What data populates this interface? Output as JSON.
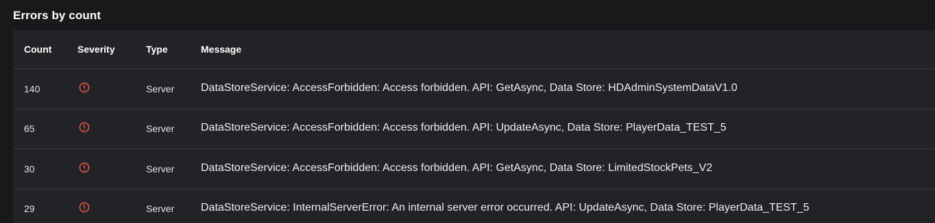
{
  "section": {
    "title": "Errors by count"
  },
  "table": {
    "headers": {
      "count": "Count",
      "severity": "Severity",
      "type": "Type",
      "message": "Message"
    },
    "rows": [
      {
        "count": "140",
        "severity_icon": "error-circle-icon",
        "type": "Server",
        "message": "DataStoreService: AccessForbidden: Access forbidden. API: GetAsync, Data Store: HDAdminSystemDataV1.0"
      },
      {
        "count": "65",
        "severity_icon": "error-circle-icon",
        "type": "Server",
        "message": "DataStoreService: AccessForbidden: Access forbidden. API: UpdateAsync, Data Store: PlayerData_TEST_5"
      },
      {
        "count": "30",
        "severity_icon": "error-circle-icon",
        "type": "Server",
        "message": "DataStoreService: AccessForbidden: Access forbidden. API: GetAsync, Data Store: LimitedStockPets_V2"
      },
      {
        "count": "29",
        "severity_icon": "error-circle-icon",
        "type": "Server",
        "message": "DataStoreService: InternalServerError: An internal server error occurred. API: UpdateAsync, Data Store: PlayerData_TEST_5"
      }
    ]
  },
  "colors": {
    "background": "#18191b",
    "table_background": "#222326",
    "divider": "#3a3b3f",
    "error_icon": "#e5534b",
    "text": "#e6e6e6"
  }
}
